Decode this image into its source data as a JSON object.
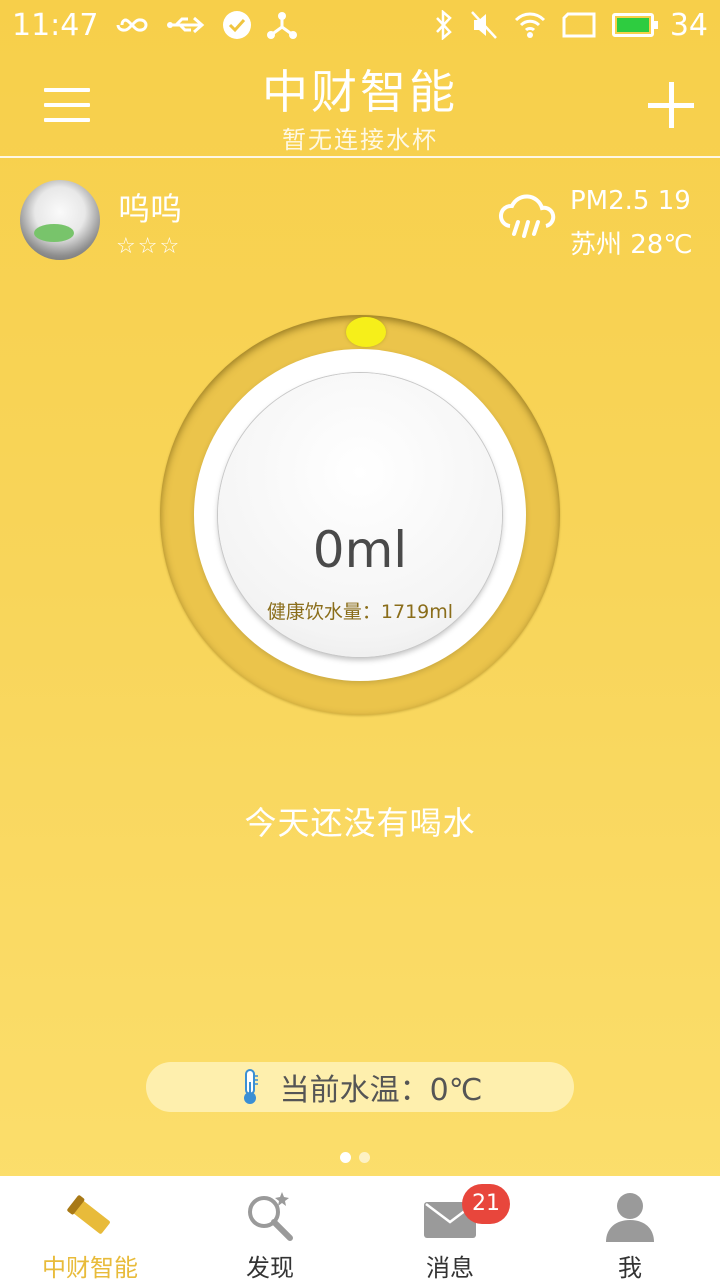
{
  "status_bar": {
    "time": "11:47",
    "battery_level": "34",
    "icons": [
      "infinity-icon",
      "usb-icon",
      "check-circle-icon",
      "share-icon",
      "bluetooth-icon",
      "mute-icon",
      "wifi-icon",
      "screen-icon",
      "battery-icon"
    ]
  },
  "header": {
    "title": "中财智能",
    "subtitle": "暂无连接水杯"
  },
  "user": {
    "name": "呜呜",
    "stars": "☆☆☆"
  },
  "weather": {
    "pm": "PM2.5  19",
    "city_temp": "苏州  28℃"
  },
  "dial": {
    "amount": "0ml",
    "healthy_label": "健康饮水量：1719ml",
    "progress_fraction": 0
  },
  "status_message": "今天还没有喝水",
  "temperature": {
    "text": "当前水温：0℃"
  },
  "pager": {
    "current": 1,
    "total": 2
  },
  "colors": {
    "background": "#f8d55a",
    "accent": "#e8bb3a",
    "knob": "#f6ef1a",
    "badge": "#e8463c"
  },
  "nav": {
    "items": [
      {
        "label": "中财智能",
        "icon": "cup-icon"
      },
      {
        "label": "发现",
        "icon": "discover-icon"
      },
      {
        "label": "消息",
        "icon": "mail-icon"
      },
      {
        "label": "我",
        "icon": "person-icon"
      }
    ],
    "message_badge": "21"
  }
}
